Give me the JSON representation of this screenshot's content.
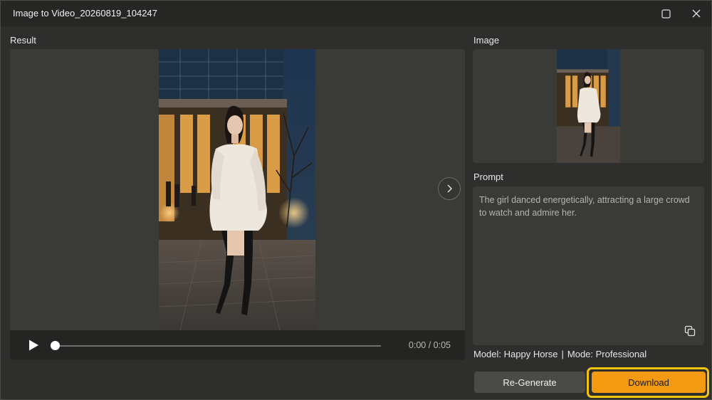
{
  "window": {
    "title": "Image to Video_20260819_104247"
  },
  "result": {
    "label": "Result",
    "time": "0:00 / 0:05",
    "progress": 0
  },
  "image": {
    "label": "Image"
  },
  "prompt": {
    "label": "Prompt",
    "text": "The girl danced energetically, attracting a large crowd to watch and admire her."
  },
  "meta": {
    "model": "Model: Happy Horse",
    "separator": "|",
    "mode": "Mode: Professional"
  },
  "actions": {
    "regenerate_label": "Re-Generate",
    "download_label": "Download"
  },
  "colors": {
    "accent": "#f19a12",
    "highlight": "#f3c40f",
    "panel": "#3a3a37",
    "background": "#2e2e2c"
  },
  "icons": {
    "maximize": "maximize-icon",
    "close": "close-icon",
    "next": "chevron-right-icon",
    "play": "play-icon",
    "copy": "copy-icon"
  }
}
